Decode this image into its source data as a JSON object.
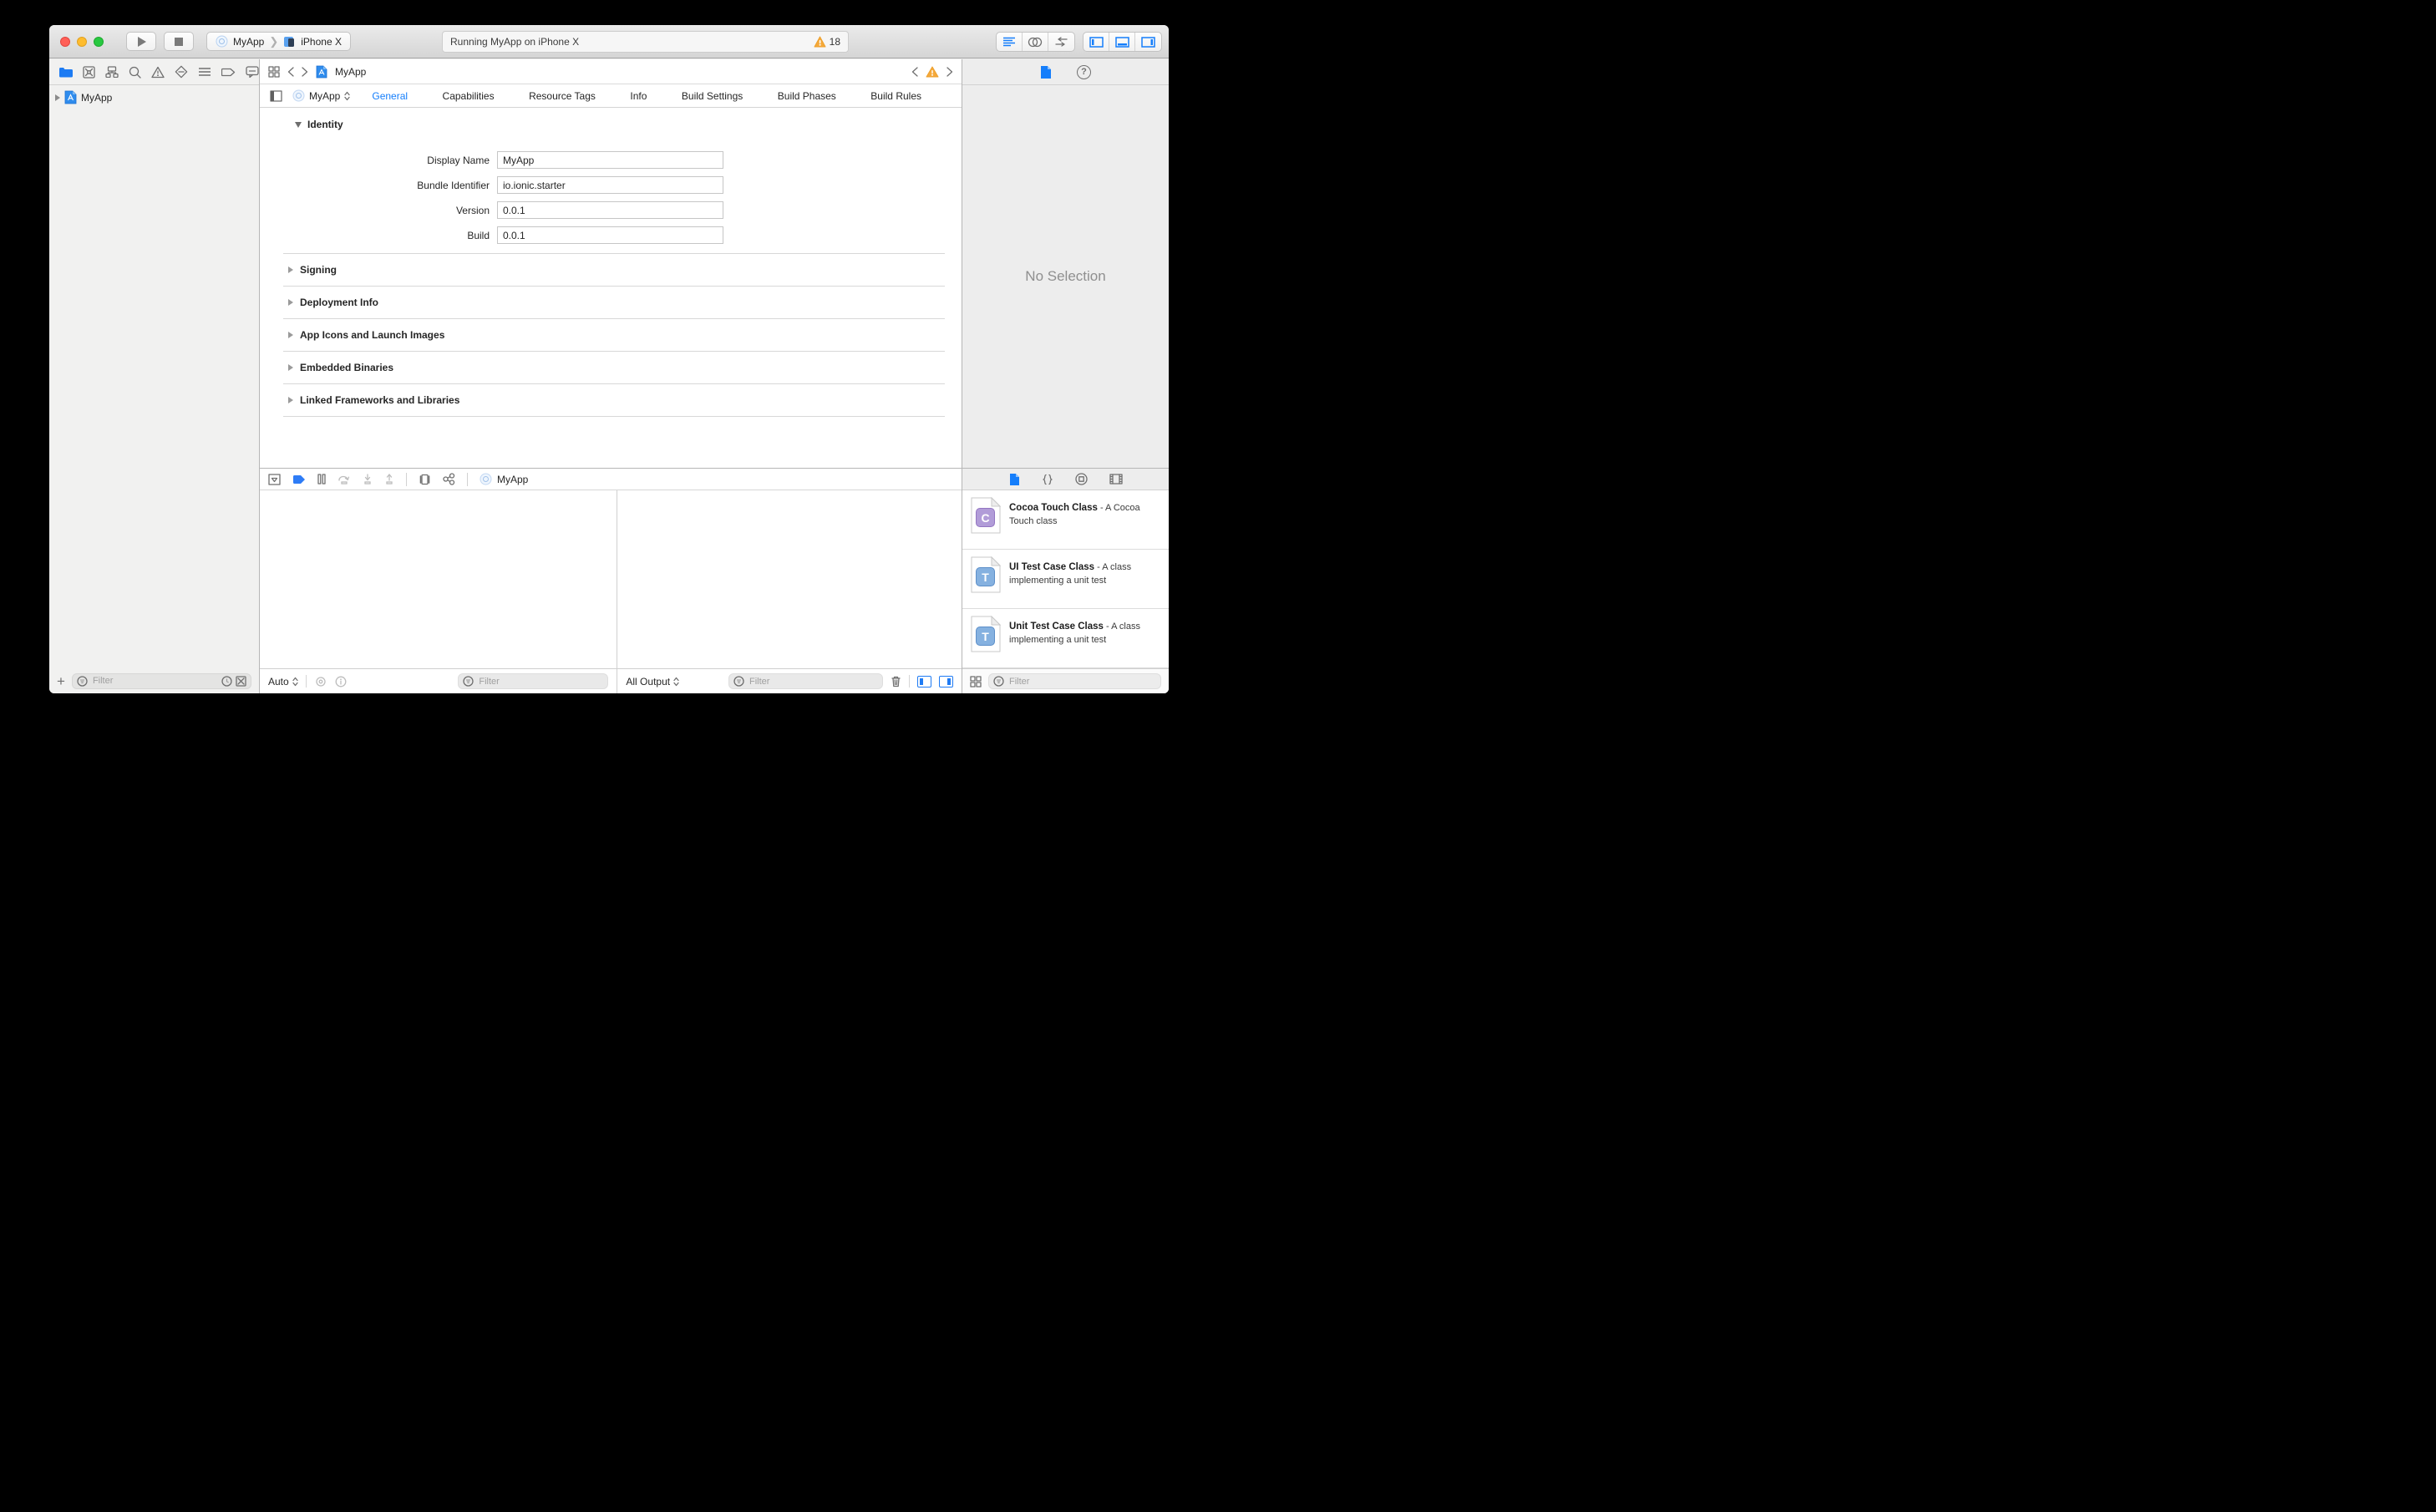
{
  "shared": {
    "filter_placeholder": "Filter",
    "plus_glyph": "+",
    "help_glyph": "?"
  },
  "toolbar": {
    "scheme_target": "MyApp",
    "scheme_device": "iPhone X",
    "status_text": "Running MyApp on iPhone X",
    "warning_count": "18"
  },
  "navigator": {
    "project_name": "MyApp"
  },
  "jumpbar": {
    "file_name": "MyApp"
  },
  "editor": {
    "target_name": "MyApp",
    "active_tab": "General",
    "tabs": [
      "General",
      "Capabilities",
      "Resource Tags",
      "Info",
      "Build Settings",
      "Build Phases",
      "Build Rules"
    ],
    "identity": {
      "title": "Identity",
      "fields": [
        {
          "label": "Display Name",
          "value": "MyApp"
        },
        {
          "label": "Bundle Identifier",
          "value": "io.ionic.starter"
        },
        {
          "label": "Version",
          "value": "0.0.1"
        },
        {
          "label": "Build",
          "value": "0.0.1"
        }
      ]
    },
    "collapsed_sections": [
      "Signing",
      "Deployment Info",
      "App Icons and Launch Images",
      "Embedded Binaries",
      "Linked Frameworks and Libraries"
    ]
  },
  "debug": {
    "target_name": "MyApp",
    "variables_scope": "Auto",
    "console_scope": "All Output"
  },
  "utilities": {
    "empty_state": "No Selection",
    "library_items": [
      {
        "badge": "C",
        "badge_color": "purple",
        "title": "Cocoa Touch Class",
        "desc": "- A Cocoa Touch class"
      },
      {
        "badge": "T",
        "badge_color": "blue",
        "title": "UI Test Case Class",
        "desc": "- A class implementing a unit test"
      },
      {
        "badge": "T",
        "badge_color": "blue",
        "title": "Unit Test Case Class",
        "desc": "- A class implementing a unit test"
      }
    ]
  },
  "colors": {
    "accent": "#157efb",
    "warning": "#f5a93b",
    "breakpoint": "#2e7cf6",
    "toolbar_top": "#ebebeb",
    "toolbar_bottom": "#d5d5d5"
  }
}
